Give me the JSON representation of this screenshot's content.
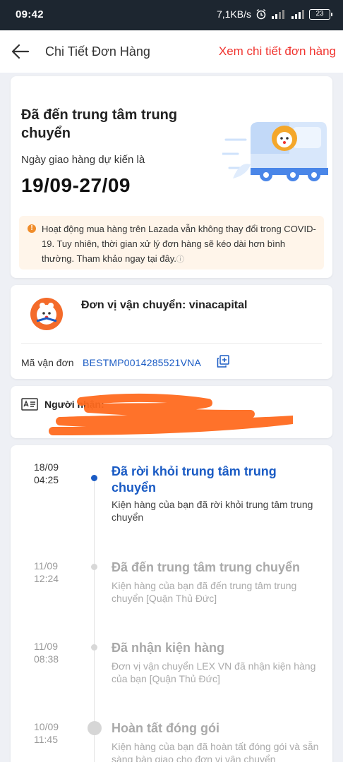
{
  "status_bar": {
    "time": "09:42",
    "network_speed": "7,1KB/s",
    "battery": "23"
  },
  "header": {
    "title": "Chi Tiết Đơn Hàng",
    "link": "Xem chi tiết đơn hàng"
  },
  "order_status": {
    "title": "Đã đến trung tâm trung chuyển",
    "eta_label": "Ngày giao hàng dự kiến là",
    "eta_value": "19/09-27/09",
    "notice": "Hoạt động mua hàng trên Lazada vẫn không thay đổi trong COVID-19. Tuy nhiên, thời gian xử lý đơn hàng sẽ kéo dài hơn bình thường. Tham khảo ngay tại đây.",
    "notice_help_icon": "question-circle-icon"
  },
  "shipping": {
    "carrier": "Đơn vị vận chuyển: vinacapital",
    "tracking_label": "Mã vận đơn",
    "tracking_code": "BESTMP0014285521VNA",
    "copy_icon": "copy-icon"
  },
  "recipient": {
    "label": "Người nhận:",
    "icon": "id-card-icon"
  },
  "timeline": [
    {
      "date": "18/09",
      "time": "04:25",
      "title": "Đã rời khỏi trung tâm trung chuyển",
      "desc": "Kiện hàng của bạn đã rời khỏi trung tâm trung chuyển",
      "active": true
    },
    {
      "date": "11/09",
      "time": "12:24",
      "title": "Đã đến trung tâm trung chuyển",
      "desc": "Kiện hàng của bạn đã đến trung tâm trung chuyển [Quận Thủ Đức]",
      "active": false
    },
    {
      "date": "11/09",
      "time": "08:38",
      "title": "Đã nhận kiện hàng",
      "desc": "Đơn vị vận chuyển LEX VN đã nhận kiện hàng của bạn [Quận Thủ Đức]",
      "active": false
    },
    {
      "date": "10/09",
      "time": "11:45",
      "title": "Hoàn tất đóng gói",
      "desc": "Kiện hàng của bạn đã hoàn tất đóng gói và sẵn sàng bàn giao cho đơn vị vận chuyển",
      "active": false
    }
  ],
  "colors": {
    "accent_red": "#f0322d",
    "link_blue": "#1a5bc4",
    "notice_bg": "#fff5ea",
    "redaction": "#ff6a1f"
  }
}
